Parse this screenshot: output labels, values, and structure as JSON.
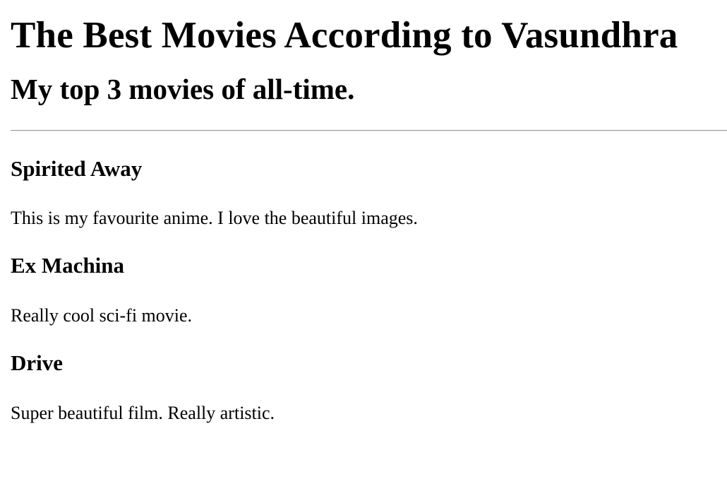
{
  "page": {
    "title": "The Best Movies According to Vasundhra",
    "subtitle": "My top 3 movies of all-time."
  },
  "movies": [
    {
      "title": "Spirited Away",
      "description": "This is my favourite anime. I love the beautiful images."
    },
    {
      "title": "Ex Machina",
      "description": "Really cool sci-fi movie."
    },
    {
      "title": "Drive",
      "description": "Super beautiful film. Really artistic."
    }
  ]
}
